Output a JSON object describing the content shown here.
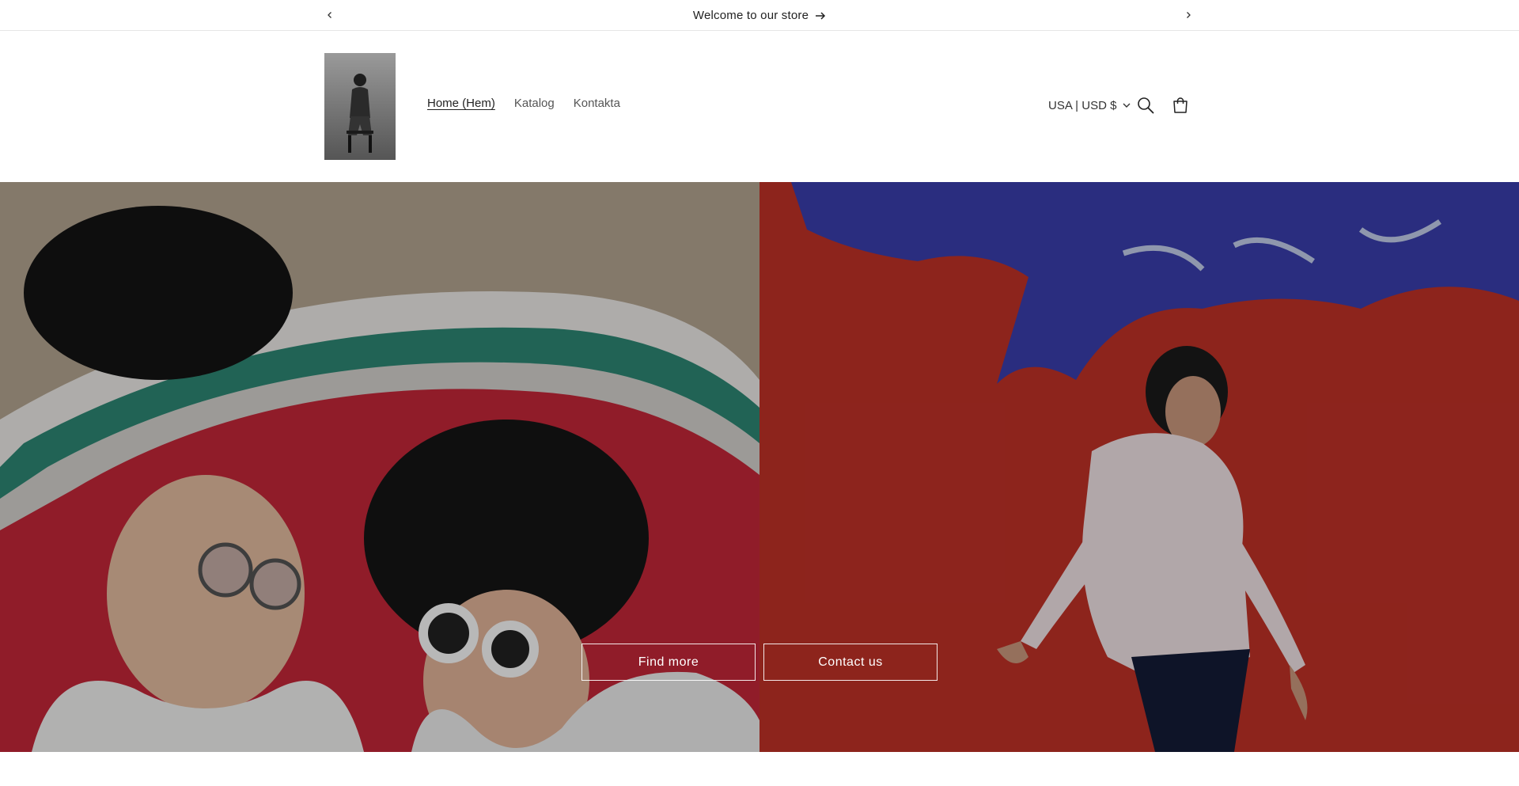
{
  "announcement": {
    "text": "Welcome to our store"
  },
  "nav": {
    "items": [
      {
        "label": "Home (Hem)",
        "active": true
      },
      {
        "label": "Katalog",
        "active": false
      },
      {
        "label": "Kontakta",
        "active": false
      }
    ]
  },
  "header": {
    "currency": "USA | USD $"
  },
  "hero": {
    "buttons": [
      {
        "label": "Find more"
      },
      {
        "label": "Contact us"
      }
    ]
  },
  "icons": {
    "prev": "chevron-left-icon",
    "next": "chevron-right-icon",
    "announcement_arrow": "arrow-right-icon",
    "search": "search-icon",
    "cart": "cart-icon",
    "currency_caret": "chevron-down-icon"
  },
  "colors": {
    "text": "#121212",
    "border": "#e6e6e6",
    "overlay": "rgba(0,0,0,0.28)"
  }
}
